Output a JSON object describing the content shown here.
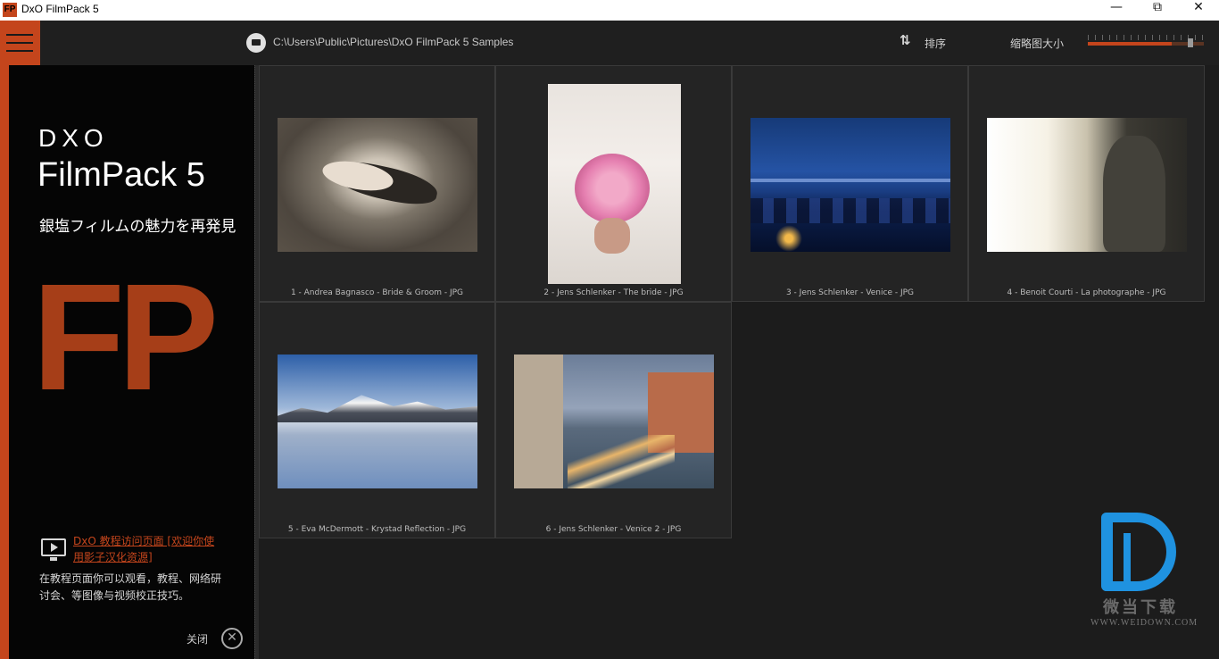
{
  "window": {
    "title": "DxO FilmPack 5",
    "icon_label": "FP",
    "minimize": "—",
    "maximize": "⧉",
    "close": "✕"
  },
  "toolbar": {
    "path": "C:\\Users\\Public\\Pictures\\DxO FilmPack 5 Samples",
    "sort_icon": "⇅",
    "sort_label": "排序",
    "thumb_size_label": "缩略图大小",
    "thumb_size_value": 0.72
  },
  "sidebar": {
    "brand_dxo": "DXO",
    "brand_name": "FilmPack 5",
    "tagline": "銀塩フィルムの魅力を再発見",
    "logo_letters": "FP",
    "tutorial_link": "DxO 教程访问页面 [欢迎你使用影子汉化资源]",
    "tutorial_desc": "在教程页面你可以观看，教程、网络研讨会、等图像与视频校正技巧。",
    "close_label": "关闭",
    "close_icon": "✕"
  },
  "photos": [
    {
      "caption": "1 - Andrea Bagnasco - Bride & Groom - JPG"
    },
    {
      "caption": "2 - Jens Schlenker - The bride - JPG"
    },
    {
      "caption": "3 - Jens Schlenker - Venice - JPG"
    },
    {
      "caption": "4 - Benoit Courti - La photographe - JPG"
    },
    {
      "caption": "5 - Eva McDermott - Krystad Reflection - JPG"
    },
    {
      "caption": "6 - Jens Schlenker - Venice 2 - JPG"
    }
  ],
  "watermark": {
    "cn": "微当下载",
    "en": "WWW.WEIDOWN.COM"
  },
  "colors": {
    "accent": "#c4451c",
    "logo": "#a63e18",
    "watermark": "#1f92e0"
  }
}
